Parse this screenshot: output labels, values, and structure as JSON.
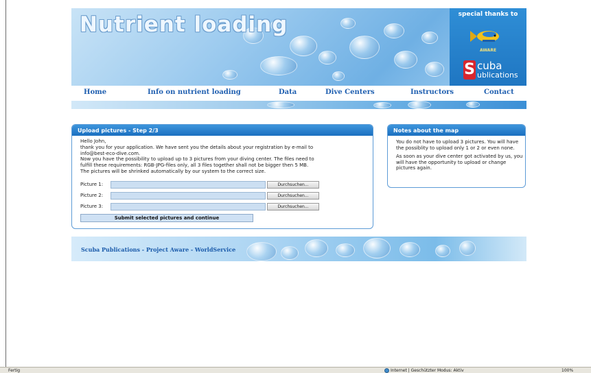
{
  "header": {
    "title": "Nutrient loading",
    "thanks_label": "special thanks to",
    "aware_label": "AWARE",
    "scuba_logo": {
      "letter": "S",
      "word": "cuba",
      "sub": "ublications"
    }
  },
  "nav": {
    "items": [
      {
        "label": "Home"
      },
      {
        "label": "Info on nutrient loading"
      },
      {
        "label": "Data"
      },
      {
        "label": "Dive Centers"
      },
      {
        "label": "Instructors"
      },
      {
        "label": "Contact"
      }
    ]
  },
  "upload": {
    "title": "Upload pictures - Step 2/3",
    "lines": [
      "Hello John,",
      "thank you for your application. We have sent you the details about your registration by e-mail to",
      "info@best-eco-dive.com.",
      "Now you have the possibility to upload up to 3 pictures from your diving center. The files need to",
      "fulfill these requirements: RGB-JPG-files only, all 3 files together shall not be bigger then 5 MB.",
      "The pictures will be shrinked automatically by our system to the correct size."
    ],
    "fields": [
      {
        "label": "Picture 1:",
        "value": "",
        "browse": "Durchsuchen..."
      },
      {
        "label": "Picture 2:",
        "value": "",
        "browse": "Durchsuchen..."
      },
      {
        "label": "Picture 3:",
        "value": "",
        "browse": "Durchsuchen..."
      }
    ],
    "submit_label": "Submit selected pictures and continue"
  },
  "notes": {
    "title": "Notes about the map",
    "paragraphs": [
      "You do not have to upload 3 pictures. You will have the possiblity to upload only 1 or 2 or even none.",
      "As soon as your dive center got activated by us, you will have the opportunity to upload or change pictures again."
    ]
  },
  "footer": {
    "text": "Scuba Publications - Project Aware - WorldService"
  },
  "statusbar": {
    "left": "Fertig",
    "zone": "Internet | Geschützter Modus: Aktiv",
    "zoom": "100%"
  },
  "colors": {
    "accent": "#1b6fc0",
    "nav_text": "#1f5fb0",
    "field_bg": "#ccdff2"
  }
}
